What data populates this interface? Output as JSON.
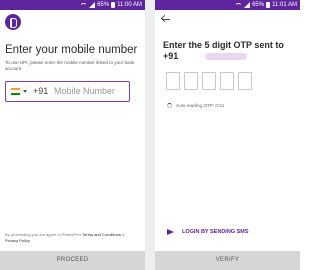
{
  "status_bar": {
    "battery": "65%",
    "time_left": "11:00 AM",
    "time_right": "11:01 AM"
  },
  "login": {
    "title": "Enter your mobile number",
    "subtitle": "To use UPI, please enter the mobile number linked to your bank account",
    "country_code": "+91",
    "mobile_placeholder": "Mobile Number",
    "terms_prefix": "By proceeding you are agree to PhonePe's",
    "terms_link": "Terms and Conditions",
    "terms_and": "&",
    "privacy_link": "Privacy Policy",
    "proceed_label": "PROCEED"
  },
  "otp": {
    "title": "Enter the 5 digit OTP sent to",
    "phone_prefix": "+91",
    "boxes": 5,
    "auto_reading": "Auto reading OTP: 0:31",
    "login_sms_label": "LOGIN BY SENDING SMS",
    "verify_label": "VERIFY"
  },
  "colors": {
    "brand": "#5f259f",
    "button_bg": "#d6d6d6"
  },
  "icons": [
    "phonepe-logo-icon",
    "india-flag-icon",
    "chevron-down-icon",
    "back-arrow-icon",
    "spinner-icon",
    "send-icon",
    "wifi-icon",
    "signal-icon",
    "battery-icon"
  ]
}
